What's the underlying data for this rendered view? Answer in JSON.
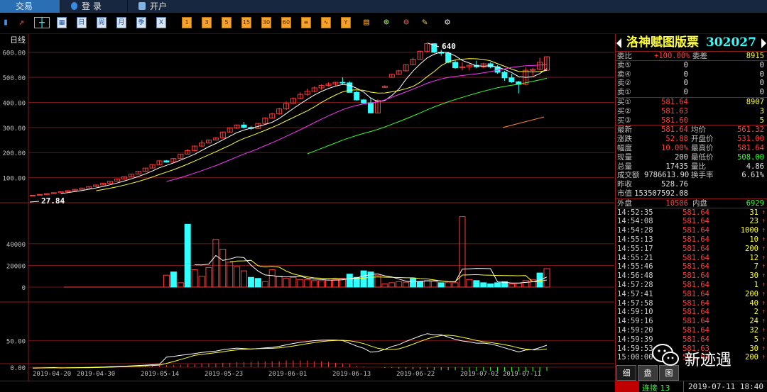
{
  "tabs": [
    {
      "label": "交易"
    },
    {
      "label": "登 录"
    },
    {
      "label": "开户"
    }
  ],
  "toolbar": {
    "period_buttons": [
      "日",
      "周",
      "月",
      "季",
      "X"
    ],
    "minute_buttons": [
      "1",
      "3",
      "5",
      "15",
      "30",
      "60"
    ]
  },
  "chart": {
    "period_label": "日线",
    "high_marker": "640",
    "low_marker": "27.84",
    "price_ticks": [
      "600.00",
      "500.00",
      "400.00",
      "300.00",
      "200.00",
      "100.00"
    ],
    "volume_ticks": [
      "40000",
      "20000",
      "0"
    ],
    "indicator_ticks": [
      "50.00",
      "0.00"
    ],
    "date_ticks": [
      "2019-04-20",
      "2019-04-30",
      "2019-05-14",
      "2019-05-23",
      "2019-06-01",
      "2019-06-13",
      "2019-06-22",
      "2019-07-02",
      "2019-07-11"
    ],
    "colors": {
      "up": "#ff3a3a",
      "down": "#33ffff",
      "ma5": "#ffffff",
      "ma10": "#ffff33",
      "ma20": "#ff33ff",
      "ma60": "#33ff33",
      "grid": "#8b1a1a"
    }
  },
  "chart_data": {
    "type": "candlestick",
    "x": [
      "2019-04-20",
      "2019-07-11"
    ],
    "candles": [
      [
        27.84,
        30,
        27.84,
        30
      ],
      [
        30,
        33,
        30,
        33
      ],
      [
        33,
        36.3,
        33,
        36.3
      ],
      [
        36.3,
        40,
        36.3,
        40
      ],
      [
        40,
        44,
        40,
        44
      ],
      [
        44,
        48.3,
        44,
        48.3
      ],
      [
        48.3,
        53.2,
        48.3,
        53.2
      ],
      [
        53.2,
        58.5,
        53.2,
        58.5
      ],
      [
        58.5,
        64.3,
        58.5,
        64.3
      ],
      [
        64.3,
        70.8,
        64.3,
        70.8
      ],
      [
        70.8,
        77.9,
        70.8,
        77.9
      ],
      [
        77.9,
        85.7,
        77.9,
        85.7
      ],
      [
        85.7,
        94.2,
        85.7,
        94.2
      ],
      [
        94.2,
        103.7,
        94.2,
        103.7
      ],
      [
        103.7,
        114,
        103.7,
        114
      ],
      [
        114,
        125.4,
        114,
        125.4
      ],
      [
        125.4,
        138,
        125.4,
        138
      ],
      [
        138,
        151.8,
        138,
        151.8
      ],
      [
        151.8,
        167,
        151.8,
        167
      ],
      [
        167,
        170,
        160,
        162
      ],
      [
        162,
        178,
        160,
        176
      ],
      [
        176,
        194,
        176,
        194
      ],
      [
        194,
        214,
        192,
        208
      ],
      [
        208,
        228,
        206,
        226
      ],
      [
        226,
        250,
        222,
        238
      ],
      [
        238,
        250,
        238,
        250
      ],
      [
        250,
        262,
        248,
        258
      ],
      [
        258,
        284,
        256,
        282
      ],
      [
        282,
        300,
        280,
        298
      ],
      [
        298,
        312,
        294,
        310
      ],
      [
        310,
        322,
        296,
        300
      ],
      [
        300,
        306,
        290,
        296
      ],
      [
        296,
        318,
        294,
        316
      ],
      [
        316,
        340,
        314,
        338
      ],
      [
        338,
        358,
        336,
        354
      ],
      [
        354,
        378,
        352,
        374
      ],
      [
        374,
        404,
        370,
        396
      ],
      [
        396,
        420,
        394,
        416
      ],
      [
        416,
        440,
        412,
        432
      ],
      [
        432,
        455,
        426,
        444
      ],
      [
        444,
        464,
        440,
        458
      ],
      [
        458,
        472,
        450,
        468
      ],
      [
        468,
        480,
        462,
        474
      ],
      [
        474,
        482,
        466,
        480
      ],
      [
        480,
        500,
        470,
        478
      ],
      [
        478,
        484,
        440,
        440
      ],
      [
        440,
        446,
        406,
        410
      ],
      [
        410,
        414,
        394,
        398
      ],
      [
        398,
        420,
        356,
        358
      ],
      [
        358,
        412,
        356,
        408
      ],
      [
        460,
        468,
        458,
        464
      ],
      [
        500,
        514,
        498,
        512
      ],
      [
        512,
        530,
        510,
        526
      ],
      [
        526,
        552,
        522,
        550
      ],
      [
        550,
        578,
        548,
        572
      ],
      [
        572,
        606,
        570,
        604
      ],
      [
        604,
        640,
        598,
        634
      ],
      [
        634,
        636,
        596,
        600
      ],
      [
        600,
        610,
        586,
        596
      ],
      [
        596,
        602,
        556,
        560
      ],
      [
        560,
        568,
        534,
        538
      ],
      [
        538,
        560,
        528,
        542
      ],
      [
        542,
        552,
        528,
        548
      ],
      [
        548,
        566,
        536,
        542
      ],
      [
        542,
        558,
        536,
        554
      ],
      [
        554,
        560,
        536,
        542
      ],
      [
        542,
        548,
        514,
        520
      ],
      [
        520,
        526,
        486,
        498
      ],
      [
        498,
        514,
        478,
        482
      ],
      [
        482,
        486,
        436,
        472
      ],
      [
        472,
        540,
        468,
        528
      ],
      [
        528,
        538,
        506,
        532
      ],
      [
        532,
        578,
        528,
        560
      ],
      [
        528,
        582,
        526,
        582
      ]
    ],
    "volume": [
      [
        0,
        "up"
      ],
      [
        0,
        "up"
      ],
      [
        0,
        "up"
      ],
      [
        0,
        "up"
      ],
      [
        0,
        "up"
      ],
      [
        0,
        "up"
      ],
      [
        0,
        "up"
      ],
      [
        0,
        "up"
      ],
      [
        0,
        "up"
      ],
      [
        0,
        "up"
      ],
      [
        0,
        "up"
      ],
      [
        0,
        "up"
      ],
      [
        0,
        "up"
      ],
      [
        0,
        "up"
      ],
      [
        0,
        "up"
      ],
      [
        0,
        "up"
      ],
      [
        0,
        "up"
      ],
      [
        0,
        "up"
      ],
      [
        0,
        "up"
      ],
      [
        11000,
        "up"
      ],
      [
        14000,
        "down"
      ],
      [
        4000,
        "up"
      ],
      [
        58000,
        "down"
      ],
      [
        16000,
        "up"
      ],
      [
        10000,
        "up"
      ],
      [
        18000,
        "up"
      ],
      [
        44000,
        "up"
      ],
      [
        35000,
        "up"
      ],
      [
        23000,
        "up"
      ],
      [
        19000,
        "up"
      ],
      [
        15000,
        "up"
      ],
      [
        9000,
        "down"
      ],
      [
        8000,
        "down"
      ],
      [
        5000,
        "up"
      ],
      [
        16000,
        "up"
      ],
      [
        10000,
        "up"
      ],
      [
        8000,
        "up"
      ],
      [
        9000,
        "up"
      ],
      [
        7000,
        "up"
      ],
      [
        7000,
        "up"
      ],
      [
        6000,
        "up"
      ],
      [
        6000,
        "up"
      ],
      [
        6500,
        "up"
      ],
      [
        7000,
        "up"
      ],
      [
        8000,
        "up"
      ],
      [
        12000,
        "down"
      ],
      [
        9000,
        "down"
      ],
      [
        15000,
        "down"
      ],
      [
        14000,
        "down"
      ],
      [
        11000,
        "up"
      ],
      [
        3000,
        "up"
      ],
      [
        4000,
        "up"
      ],
      [
        5000,
        "up"
      ],
      [
        4500,
        "up"
      ],
      [
        8000,
        "down"
      ],
      [
        5000,
        "down"
      ],
      [
        6000,
        "up"
      ],
      [
        5500,
        "up"
      ],
      [
        4000,
        "down"
      ],
      [
        4500,
        "up"
      ],
      [
        4000,
        "up"
      ],
      [
        65000,
        "up"
      ],
      [
        7000,
        "up"
      ],
      [
        6000,
        "down"
      ],
      [
        4000,
        "down"
      ],
      [
        3000,
        "down"
      ],
      [
        4000,
        "down"
      ],
      [
        5000,
        "down"
      ],
      [
        3000,
        "up"
      ],
      [
        3500,
        "up"
      ],
      [
        6000,
        "up"
      ],
      [
        7000,
        "up"
      ],
      [
        13000,
        "down"
      ],
      [
        17000,
        "up"
      ]
    ],
    "macd_bars": [
      0,
      0,
      0,
      0,
      0,
      0,
      0,
      0,
      0,
      0,
      0,
      0,
      0,
      0,
      0,
      0,
      1,
      2,
      2,
      3,
      3,
      3,
      4,
      4,
      5,
      5,
      5,
      6,
      6,
      7,
      7,
      7,
      8,
      8,
      8,
      8,
      9,
      9,
      9,
      9,
      8,
      8,
      7,
      6,
      5,
      4,
      2,
      1,
      0,
      0,
      -1,
      -1,
      -2,
      -2,
      -3,
      -3,
      -3,
      -4,
      -4,
      -4,
      -4,
      -4,
      -5,
      -5,
      -5,
      -5,
      -5,
      -5,
      -6,
      -6,
      -6,
      -6,
      -6,
      -5
    ],
    "high": 640,
    "low": 27.84,
    "ylim_price": [
      0,
      650
    ],
    "ylim_volume": [
      0,
      70000
    ],
    "ylim_indicator": [
      -20,
      80
    ]
  },
  "panel": {
    "title": "洛神赋图版票",
    "code": "302027",
    "stats1": [
      {
        "label": "委比",
        "val": "+100.00%",
        "label2": "委差",
        "val2": "8915",
        "c1": "red",
        "c2": "yellow"
      }
    ],
    "sell": [
      {
        "label": "卖⑤",
        "price": "0",
        "vol": "0"
      },
      {
        "label": "卖④",
        "price": "0",
        "vol": "0"
      },
      {
        "label": "卖②",
        "price": "0",
        "vol": "0"
      },
      {
        "label": "卖①",
        "price": "0",
        "vol": "0"
      }
    ],
    "buy": [
      {
        "label": "买①",
        "price": "581.64",
        "vol": "8907"
      },
      {
        "label": "买②",
        "price": "581.63",
        "vol": "3"
      },
      {
        "label": "买③",
        "price": "581.60",
        "vol": "5"
      }
    ],
    "quotes": [
      {
        "l1": "最新",
        "v1": "581.64",
        "c1": "red",
        "l2": "均价",
        "v2": "561.32",
        "c2": "red"
      },
      {
        "l1": "涨跌",
        "v1": "52.88",
        "c1": "red",
        "l2": "开盘价",
        "v2": "531.00",
        "c2": "red"
      },
      {
        "l1": "幅度",
        "v1": "10.00%",
        "c1": "red",
        "l2": "最高价",
        "v2": "581.64",
        "c2": "red"
      },
      {
        "l1": "现量",
        "v1": "200",
        "c1": "white",
        "l2": "最低价",
        "v2": "508.00",
        "c2": "green"
      },
      {
        "l1": "总量",
        "v1": "17435",
        "c1": "white",
        "l2": "量比",
        "v2": "4.86",
        "c2": "white"
      },
      {
        "l1": "成交额",
        "v1": "9786613.90",
        "c1": "white",
        "l2": "换手率",
        "v2": "6.61%",
        "c2": "white"
      }
    ],
    "prev_close_label": "昨收",
    "prev_close": "528.76",
    "mkt_value_label": "市值",
    "mkt_value": "153507592.08",
    "outer_label": "外盘",
    "outer": "10506",
    "inner_label": "内盘",
    "inner": "6929",
    "ticks": [
      {
        "t": "14:52:35",
        "p": "581.64",
        "v": "31"
      },
      {
        "t": "14:54:08",
        "p": "581.64",
        "v": "23"
      },
      {
        "t": "14:54:28",
        "p": "581.64",
        "v": "1000"
      },
      {
        "t": "14:55:13",
        "p": "581.64",
        "v": "10"
      },
      {
        "t": "14:55:17",
        "p": "581.64",
        "v": "200"
      },
      {
        "t": "14:55:21",
        "p": "581.64",
        "v": "12"
      },
      {
        "t": "14:55:46",
        "p": "581.64",
        "v": "7"
      },
      {
        "t": "14:56:48",
        "p": "581.64",
        "v": "30"
      },
      {
        "t": "14:57:28",
        "p": "581.64",
        "v": "1"
      },
      {
        "t": "14:57:41",
        "p": "581.64",
        "v": "200"
      },
      {
        "t": "14:57:58",
        "p": "581.64",
        "v": "40"
      },
      {
        "t": "14:59:10",
        "p": "581.64",
        "v": "2"
      },
      {
        "t": "14:59:16",
        "p": "581.64",
        "v": "24"
      },
      {
        "t": "14:59:20",
        "p": "581.64",
        "v": "32"
      },
      {
        "t": "14:59:39",
        "p": "581.64",
        "v": "5"
      },
      {
        "t": "14:59:53",
        "p": "581.63",
        "v": "30"
      },
      {
        "t": "15:00:00",
        "p": "581.64",
        "v": "200"
      }
    ],
    "tabs": [
      "细",
      "盘",
      "图"
    ]
  },
  "watermark": {
    "text": "新迹遇",
    "icon": "wechat-icon"
  },
  "status": {
    "connection": "连接 13",
    "datetime": "2019-07-11 18:40"
  }
}
